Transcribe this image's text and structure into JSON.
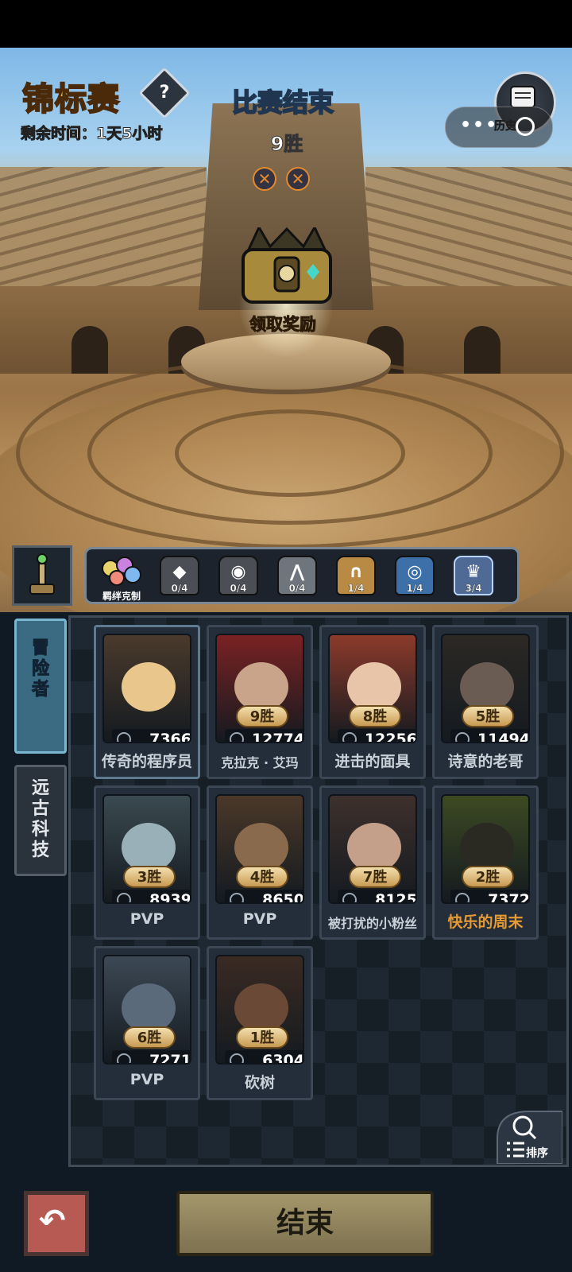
{
  "header": {
    "title": "锦标赛",
    "help_symbol": "?",
    "remaining_time": "剩余时间：1天5小时",
    "match_status": "比赛结束",
    "wins": "9胜",
    "losses": [
      "✕",
      "✕"
    ],
    "claim_reward": "领取奖励",
    "history_label": "历史",
    "capsule_dots": "•••"
  },
  "bond_bar": {
    "main_label": "羁绊克制",
    "items": [
      {
        "icon": "diamond-icon",
        "count": "0/4",
        "color": "#4b4f55"
      },
      {
        "icon": "eye-icon",
        "count": "0/4",
        "color": "#4b4f55"
      },
      {
        "icon": "claw-icon",
        "count": "0/4",
        "color": "#6f757c"
      },
      {
        "icon": "arch-icon",
        "count": "1/4",
        "color": "#b88a44"
      },
      {
        "icon": "ring-icon",
        "count": "1/4",
        "color": "#3d6fa8"
      },
      {
        "icon": "crown-icon",
        "count": "3/4",
        "color": "#4f6a94"
      }
    ]
  },
  "tabs": {
    "adventurer": "冒险者",
    "ancient_tech": "远古科技"
  },
  "cards": [
    {
      "wins": "",
      "score": "7366",
      "name": "传奇的程序员",
      "bg": "#4a3a2c",
      "face": "#e9c78c"
    },
    {
      "wins": "9胜",
      "score": "12774",
      "name": "克拉克 · 艾玛",
      "bg": "#7a2222",
      "face": "#c9a48a"
    },
    {
      "wins": "8胜",
      "score": "12256",
      "name": "进击的面具",
      "bg": "#8c3a2a",
      "face": "#e8c4a8"
    },
    {
      "wins": "5胜",
      "score": "11494",
      "name": "诗意的老哥",
      "bg": "#2c2824",
      "face": "#6a5c52"
    },
    {
      "wins": "3胜",
      "score": "8939",
      "name": "PVP",
      "bg": "#3a4a50",
      "face": "#9ab0b8"
    },
    {
      "wins": "4胜",
      "score": "8650",
      "name": "PVP",
      "bg": "#4a3828",
      "face": "#8a6a4c"
    },
    {
      "wins": "7胜",
      "score": "8125",
      "name": "被打扰的小粉丝",
      "bg": "#3e302c",
      "face": "#c4a08a"
    },
    {
      "wins": "2胜",
      "score": "7372",
      "name": "快乐的周末",
      "bg": "#3c4a22",
      "face": "#2a2a22"
    },
    {
      "wins": "6胜",
      "score": "7271",
      "name": "PVP",
      "bg": "#3c4854",
      "face": "#5a6a7a"
    },
    {
      "wins": "1胜",
      "score": "6304",
      "name": "砍树",
      "bg": "#3a2a22",
      "face": "#6a4a36"
    }
  ],
  "sort_label": "排序",
  "end_button": "结束",
  "colors": {
    "accent_gold": "#f5b93b",
    "name_orange": "#e79a33",
    "end_button": "#a4976c",
    "back_button": "#b85a54"
  }
}
